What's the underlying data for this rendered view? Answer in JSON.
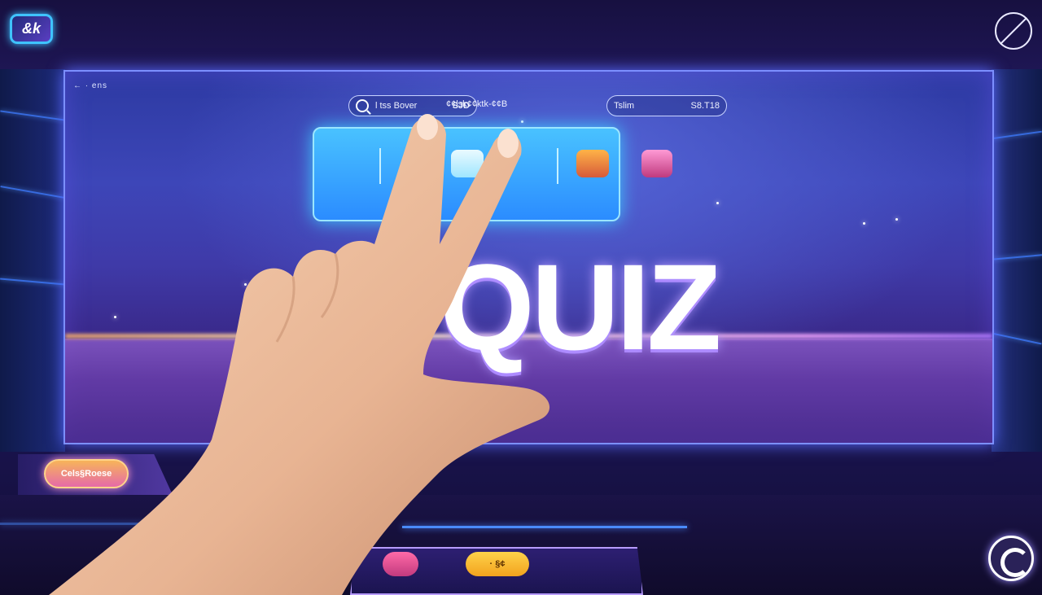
{
  "hud": {
    "corner_label": "← · ens",
    "search_text": "l tss Bover",
    "search_badge": "SJD",
    "middle_text": "¢¢lsk¢¢ktk-¢¢B",
    "right_label": "Tslim",
    "right_value": "S8.T18"
  },
  "main": {
    "title": "QUIZ"
  },
  "top_bar": {
    "logo_text": "&k"
  },
  "left_panel": {
    "button_label": "Cels§Roese"
  },
  "console": {
    "gold_button_label": "· §¢"
  },
  "colors": {
    "accent_blue": "#3ec8ff",
    "neon_purple": "#b79bff",
    "orange": "#f7b45a"
  },
  "icons": {
    "mute": "mute-icon",
    "power": "power-icon",
    "search": "search-icon",
    "emblems": [
      "shield-emblem-icon",
      "heart-shield-icon",
      "orange-shield-icon"
    ]
  }
}
